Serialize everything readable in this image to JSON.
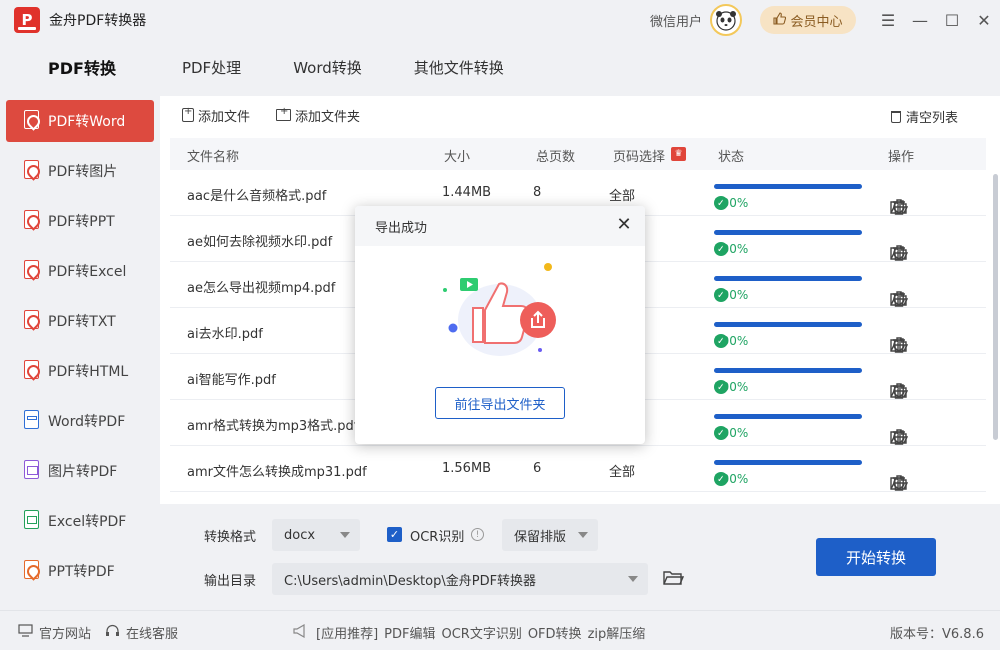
{
  "app": {
    "title": "金舟PDF转换器",
    "logo_letter": "P"
  },
  "titlebar": {
    "wechat_user": "微信用户",
    "vip_label": "会员中心"
  },
  "top_tabs": [
    {
      "label": "PDF转换",
      "active": true
    },
    {
      "label": "PDF处理",
      "active": false
    },
    {
      "label": "Word转换",
      "active": false
    },
    {
      "label": "其他文件转换",
      "active": false
    }
  ],
  "sidebar": {
    "items": [
      {
        "label": "PDF转Word",
        "icon": "pdf-to-word-icon",
        "active": true
      },
      {
        "label": "PDF转图片",
        "icon": "pdf-to-image-icon"
      },
      {
        "label": "PDF转PPT",
        "icon": "pdf-to-ppt-icon"
      },
      {
        "label": "PDF转Excel",
        "icon": "pdf-to-excel-icon"
      },
      {
        "label": "PDF转TXT",
        "icon": "pdf-to-txt-icon"
      },
      {
        "label": "PDF转HTML",
        "icon": "pdf-to-html-icon"
      },
      {
        "label": "Word转PDF",
        "icon": "word-to-pdf-icon"
      },
      {
        "label": "图片转PDF",
        "icon": "image-to-pdf-icon"
      },
      {
        "label": "Excel转PDF",
        "icon": "excel-to-pdf-icon"
      },
      {
        "label": "PPT转PDF",
        "icon": "ppt-to-pdf-icon"
      }
    ]
  },
  "toolbar": {
    "add_file": "添加文件",
    "add_folder": "添加文件夹",
    "clear_list": "清空列表"
  },
  "table": {
    "headers": {
      "name": "文件名称",
      "size": "大小",
      "pages": "总页数",
      "range": "页码选择",
      "status": "状态",
      "ops": "操作"
    },
    "rows": [
      {
        "name": "aac是什么音频格式.pdf",
        "size": "1.44MB",
        "pages": "8",
        "range": "全部",
        "status": "100%",
        "progress": 1.0
      },
      {
        "name": "ae如何去除视频水印.pdf",
        "size": "",
        "pages": "",
        "range": "",
        "status": "100%",
        "progress": 1.0
      },
      {
        "name": "ae怎么导出视频mp4.pdf",
        "size": "",
        "pages": "",
        "range": "",
        "status": "100%",
        "progress": 1.0
      },
      {
        "name": "ai去水印.pdf",
        "size": "",
        "pages": "",
        "range": "",
        "status": "100%",
        "progress": 1.0
      },
      {
        "name": "ai智能写作.pdf",
        "size": "",
        "pages": "",
        "range": "",
        "status": "100%",
        "progress": 1.0
      },
      {
        "name": "amr格式转换为mp3格式.pdf",
        "size": "",
        "pages": "",
        "range": "",
        "status": "100%",
        "progress": 1.0
      },
      {
        "name": "amr文件怎么转换成mp31.pdf",
        "size": "1.56MB",
        "pages": "6",
        "range": "全部",
        "status": "100%",
        "progress": 1.0
      }
    ]
  },
  "settings": {
    "format_label": "转换格式",
    "format_value": "docx",
    "ocr_label": "OCR识别",
    "ocr_checked": true,
    "layout_value": "保留排版",
    "output_label": "输出目录",
    "output_path": "C:\\Users\\admin\\Desktop\\金舟PDF转换器",
    "start_button": "开始转换"
  },
  "statusbar": {
    "website": "官方网站",
    "support": "在线客服",
    "recommend": "[应用推荐]",
    "links": [
      "PDF编辑",
      "OCR文字识别",
      "OFD转换",
      "zip解压缩"
    ],
    "version": "版本号：V6.8.6"
  },
  "modal": {
    "title": "导出成功",
    "button": "前往导出文件夹"
  },
  "colors": {
    "accent": "#1e5fc8",
    "active_red": "#dd4a3f",
    "success": "#1fa463"
  }
}
